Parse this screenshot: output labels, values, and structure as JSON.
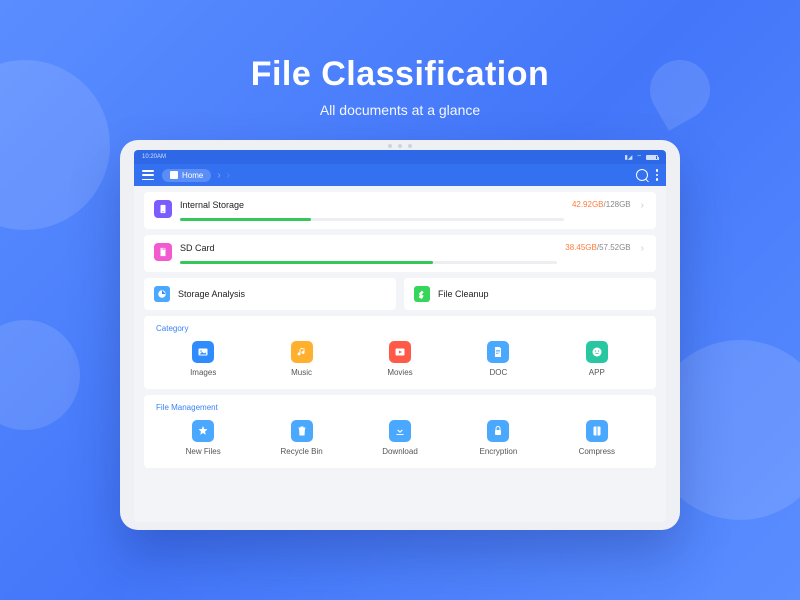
{
  "hero": {
    "title": "File Classification",
    "subtitle": "All documents at a glance"
  },
  "statusbar": {
    "time": "10:20AM"
  },
  "breadcrumb": {
    "home": "Home"
  },
  "storage": [
    {
      "name": "Internal Storage",
      "used": "42.92GB",
      "total": "128GB",
      "pct": 34,
      "color": "bg-purple"
    },
    {
      "name": "SD Card",
      "used": "38.45GB",
      "total": "57.52GB",
      "pct": 67,
      "color": "bg-pink"
    }
  ],
  "tools": [
    {
      "label": "Storage Analysis",
      "color": "bg-sky"
    },
    {
      "label": "File Cleanup",
      "color": "bg-green"
    }
  ],
  "sections": {
    "category": {
      "title": "Category",
      "items": [
        {
          "label": "Images",
          "color": "bg-blue",
          "icon": "image"
        },
        {
          "label": "Music",
          "color": "bg-orange",
          "icon": "music"
        },
        {
          "label": "Movies",
          "color": "bg-red",
          "icon": "movie"
        },
        {
          "label": "DOC",
          "color": "bg-sky",
          "icon": "doc"
        },
        {
          "label": "APP",
          "color": "bg-teal",
          "icon": "app"
        }
      ]
    },
    "management": {
      "title": "File Management",
      "items": [
        {
          "label": "New Files",
          "color": "bg-sky",
          "icon": "star"
        },
        {
          "label": "Recycle Bin",
          "color": "bg-sky",
          "icon": "trash"
        },
        {
          "label": "Download",
          "color": "bg-sky",
          "icon": "download"
        },
        {
          "label": "Encryption",
          "color": "bg-sky",
          "icon": "lock"
        },
        {
          "label": "Compress",
          "color": "bg-sky",
          "icon": "compress"
        }
      ]
    }
  }
}
